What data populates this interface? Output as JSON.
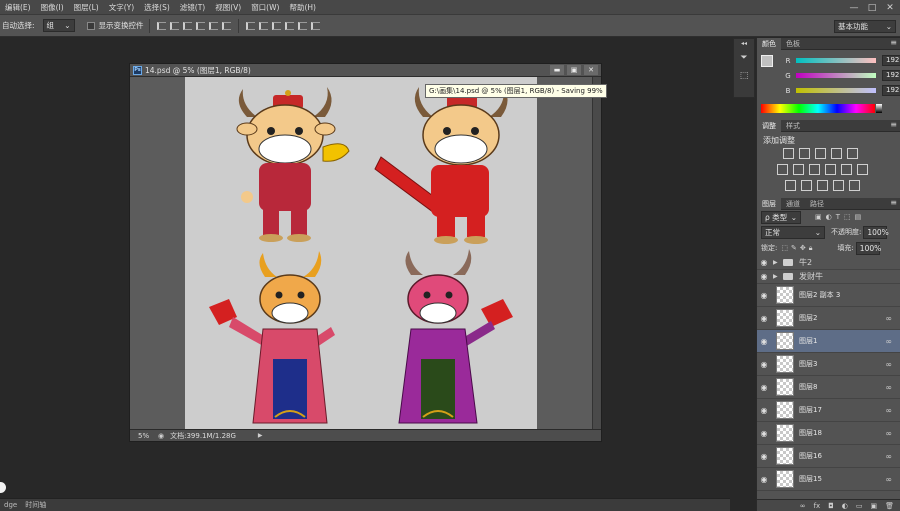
{
  "menu": [
    "编辑(E)",
    "图像(I)",
    "图层(L)",
    "文字(Y)",
    "选择(S)",
    "滤镜(T)",
    "视图(V)",
    "窗口(W)",
    "帮助(H)"
  ],
  "window_controls": [
    "—",
    "□",
    "✕"
  ],
  "options_bar": {
    "auto_select_label": "自动选择:",
    "auto_select_value": "组",
    "show_transform_label": "显示变换控件",
    "workspace_preset": "基本功能"
  },
  "document": {
    "title": "14.psd @ 5% (图层1, RGB/8)",
    "zoom": "5%",
    "doc_size": "文档:399.1M/1.28G"
  },
  "tooltip": "G:\\画集\\14.psd @ 5% (图层1, RGB/8) - Saving 99%",
  "bottom_tabs": [
    "dge",
    "时间轴"
  ],
  "color_panel": {
    "tabs": [
      "颜色",
      "色板"
    ],
    "channels": [
      {
        "label": "R",
        "value": "192"
      },
      {
        "label": "G",
        "value": "192"
      },
      {
        "label": "B",
        "value": "192"
      }
    ]
  },
  "adjust_panel": {
    "tabs": [
      "调整",
      "样式"
    ],
    "title": "添加调整"
  },
  "layers_panel": {
    "tabs": [
      "图层",
      "通道",
      "路径"
    ],
    "filter_label": "ρ 类型",
    "blend_mode": "正常",
    "opacity_label": "不透明度:",
    "opacity_value": "100%",
    "lock_label": "锁定:",
    "fill_label": "填充:",
    "fill_value": "100%",
    "groups": [
      {
        "name": "牛2"
      },
      {
        "name": "发财牛"
      }
    ],
    "layers": [
      {
        "name": "图层2 副本 3",
        "selected": false,
        "linked": false
      },
      {
        "name": "图层2",
        "selected": false,
        "linked": true
      },
      {
        "name": "图层1",
        "selected": true,
        "linked": true
      },
      {
        "name": "图层3",
        "selected": false,
        "linked": true
      },
      {
        "name": "图层8",
        "selected": false,
        "linked": true
      },
      {
        "name": "图层17",
        "selected": false,
        "linked": true
      },
      {
        "name": "图层18",
        "selected": false,
        "linked": true
      },
      {
        "name": "图层16",
        "selected": false,
        "linked": true
      },
      {
        "name": "图层15",
        "selected": false,
        "linked": true
      }
    ]
  },
  "colors": {
    "selected_layer": "#5e6d87",
    "panel_bg": "#535353",
    "canvas_bg": "#cdcdcd"
  }
}
